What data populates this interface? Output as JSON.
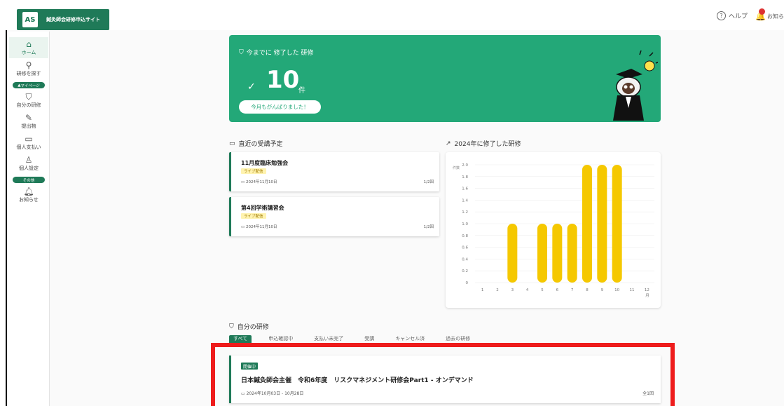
{
  "header": {
    "logo_mark": "AS",
    "site_title": "鍼灸師会研修申込サイト",
    "help_label": "ヘルプ",
    "notice_label": "お知らせ"
  },
  "sidebar": {
    "items": [
      {
        "label": "ホーム",
        "icon": "home-icon"
      },
      {
        "label": "研修を探す",
        "icon": "search-icon"
      }
    ],
    "section_mypage": "マイページ",
    "mypage_items": [
      {
        "label": "自分の研修",
        "icon": "bookmark-icon"
      },
      {
        "label": "提出物",
        "icon": "edit-icon"
      },
      {
        "label": "個人支払い",
        "icon": "card-icon"
      },
      {
        "label": "個人設定",
        "icon": "user-icon"
      }
    ],
    "section_other": "その他",
    "other_items": [
      {
        "label": "お知らせ",
        "icon": "bell-icon"
      }
    ]
  },
  "banner": {
    "title": "今までに 修了した 研修",
    "count": "10",
    "unit": "件",
    "button_label": "今月もがんばりました！"
  },
  "upcoming": {
    "title": "直近の受講予定",
    "cards": [
      {
        "title": "11月度臨床勉強会",
        "tag": "ライブ配信",
        "date": "2024年11月10日",
        "count": "1/2回"
      },
      {
        "title": "第4回学術講習会",
        "tag": "ライブ配信",
        "date": "2024年11月10日",
        "count": "1/2回"
      }
    ]
  },
  "completed_chart_title": "2024年に修了した研修",
  "chart_data": {
    "type": "bar",
    "categories": [
      "1",
      "2",
      "3",
      "4",
      "5",
      "6",
      "7",
      "8",
      "9",
      "10",
      "11",
      "12"
    ],
    "values": [
      0,
      0,
      1,
      0,
      1,
      1,
      1,
      2,
      2,
      2,
      0,
      0
    ],
    "ylabel": "件数",
    "xlabel": "月",
    "ylim": [
      0,
      2.0
    ],
    "yticks": [
      "2.0",
      "1.8",
      "1.6",
      "1.4",
      "1.2",
      "1.0",
      "0.8",
      "0.6",
      "0.4",
      "0.2",
      "0"
    ],
    "bar_color": "#f5c800"
  },
  "my_courses": {
    "title": "自分の研修",
    "tabs": [
      "すべて",
      "申込確認中",
      "支払い未完了",
      "受講",
      "キャンセル済",
      "過去の研修"
    ],
    "card": {
      "status": "開催中",
      "title": "日本鍼灸師会主催　令和6年度　リスクマネジメント研修会Part1 - オンデマンド",
      "date": "2024年10月03日 - 10月28日",
      "count": "全1回"
    }
  },
  "colors": {
    "accent": "#1f7a58",
    "banner": "#23a878",
    "bar": "#f5c800",
    "highlight": "#ee1c1c"
  }
}
